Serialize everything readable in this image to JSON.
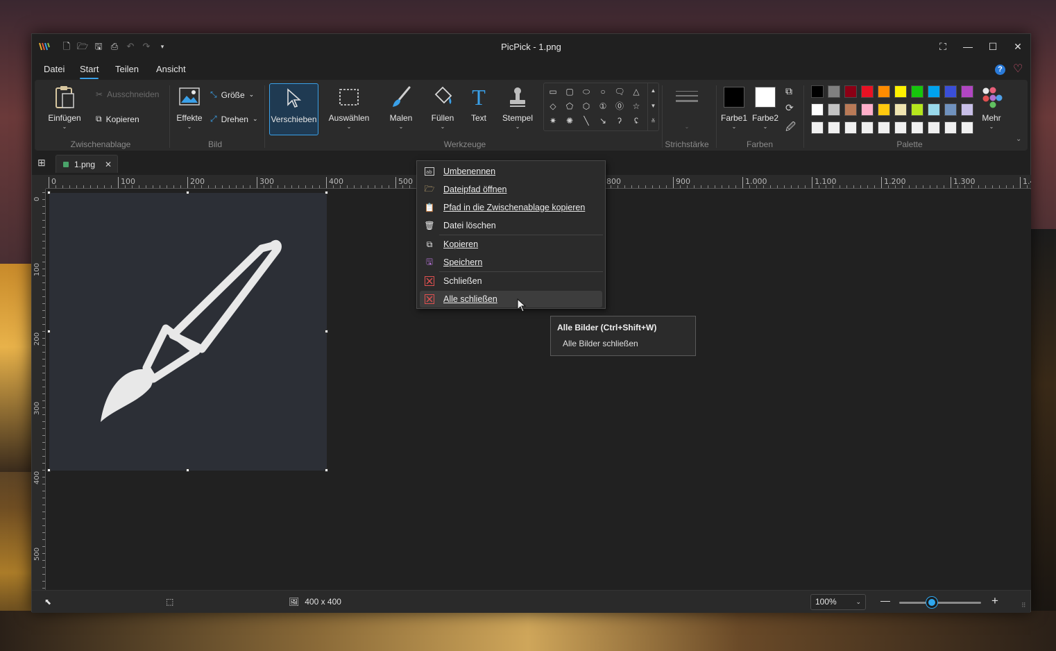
{
  "window": {
    "title": "PicPick - 1.png",
    "controls": {
      "capture": "⛶",
      "minimize": "—",
      "maximize": "☐",
      "close": "✕"
    }
  },
  "quick_access": [
    "new-icon",
    "open-icon",
    "save-icon",
    "print-icon",
    "undo-icon",
    "redo-icon",
    "customize-icon"
  ],
  "menu": {
    "tabs": [
      "Datei",
      "Start",
      "Teilen",
      "Ansicht"
    ],
    "active": "Start"
  },
  "ribbon": {
    "clipboard": {
      "paste": "Einfügen",
      "cut": "Ausschneiden",
      "copy": "Kopieren",
      "group": "Zwischenablage"
    },
    "image": {
      "effects": "Effekte",
      "size": "Größe",
      "rotate": "Drehen",
      "group": "Bild"
    },
    "tools": {
      "move": "Verschieben",
      "select": "Auswählen",
      "paint": "Malen",
      "fill": "Füllen",
      "text": "Text",
      "stamp": "Stempel",
      "group": "Werkzeuge"
    },
    "stroke": {
      "group": "Strichstärke"
    },
    "colors": {
      "color1": "Farbe1",
      "color2": "Farbe2",
      "group": "Farben",
      "color1_value": "#000000",
      "color2_value": "#ffffff"
    },
    "palette": {
      "group": "Palette",
      "more": "Mehr",
      "swatches": [
        "#000000",
        "#808080",
        "#8b0015",
        "#e81123",
        "#ff8c00",
        "#fff100",
        "#16c60c",
        "#00a2ed",
        "#3a4fd8",
        "#b146c2",
        "#ffffff",
        "#c3c3c3",
        "#b97a57",
        "#ffaec9",
        "#ffc90e",
        "#efe4b0",
        "#b5e61d",
        "#99d9ea",
        "#7092be",
        "#c8bfe7",
        "#f0f0f0",
        "#f0f0f0",
        "#f0f0f0",
        "#f0f0f0",
        "#f0f0f0",
        "#f0f0f0",
        "#f0f0f0",
        "#f0f0f0",
        "#f0f0f0",
        "#f0f0f0"
      ]
    }
  },
  "doc_tab": {
    "name": "1.png"
  },
  "ruler": {
    "h_labels": [
      "0",
      "100",
      "200",
      "300",
      "400",
      "500",
      "800",
      "900",
      "1.000",
      "1.100",
      "1.200",
      "1.300",
      "1.4"
    ],
    "v_labels": [
      "0",
      "100",
      "200",
      "300",
      "400",
      "500"
    ]
  },
  "context_menu": {
    "items": [
      {
        "icon": "rename-icon",
        "label": "Umbenennen"
      },
      {
        "icon": "open-folder-icon",
        "label": "Dateipfad öffnen"
      },
      {
        "icon": "clipboard-icon",
        "label": "Pfad in die Zwischenablage kopieren"
      },
      {
        "icon": "trash-icon",
        "label": "Datei löschen"
      },
      {
        "icon": "copy-icon",
        "label": "Kopieren"
      },
      {
        "icon": "save-icon",
        "label": "Speichern"
      },
      {
        "icon": "close-icon",
        "label": "Schließen"
      },
      {
        "icon": "close-all-icon",
        "label": "Alle schließen"
      }
    ],
    "hover_index": 7
  },
  "tooltip": {
    "title": "Alle Bilder (Ctrl+Shift+W)",
    "body": "Alle Bilder schließen"
  },
  "status": {
    "dimensions": "400 x 400",
    "zoom": "100%",
    "zoom_minus": "—",
    "zoom_plus": "+"
  }
}
